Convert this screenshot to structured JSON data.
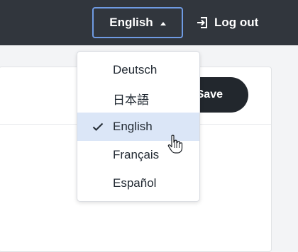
{
  "header": {
    "language_button": {
      "label": "English",
      "icon": "caret-up-icon"
    },
    "logout_button": {
      "label": "Log out",
      "icon": "logout-icon"
    }
  },
  "page": {
    "save_label": "Save"
  },
  "language_menu": {
    "items": [
      {
        "label": "Deutsch",
        "selected": false
      },
      {
        "label": "日本語",
        "selected": false
      },
      {
        "label": "English",
        "selected": true
      },
      {
        "label": "Français",
        "selected": false
      },
      {
        "label": "Español",
        "selected": false
      }
    ]
  },
  "colors": {
    "topbar": "#31363d",
    "focus_ring": "#6f9be3",
    "selected_item": "#dbe6f7",
    "save_button": "#22272d"
  }
}
